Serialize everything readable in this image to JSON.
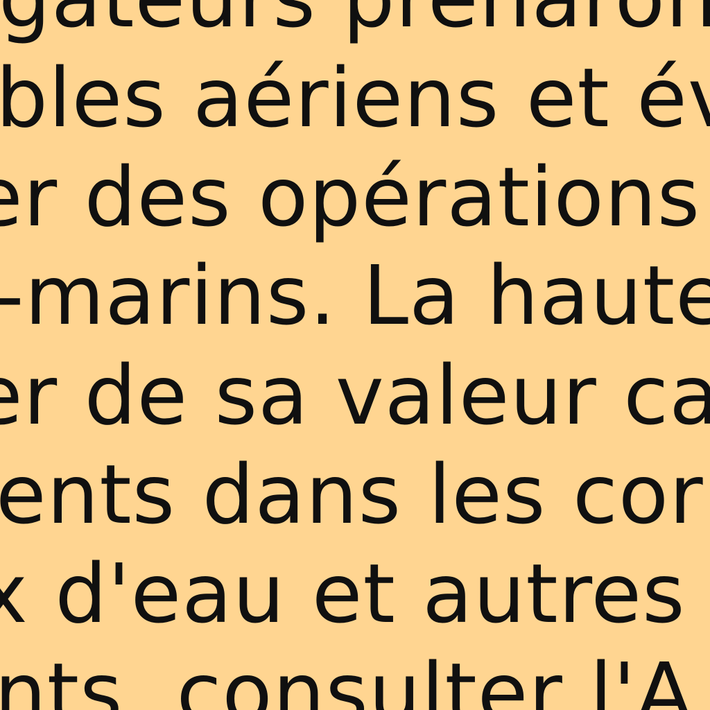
{
  "document": {
    "background": "#FFD591",
    "text_color": "#101010",
    "lines": [
      "gateurs prenaron",
      "bles aériens et év",
      "er des opérations d",
      "-marins. La haute",
      "er de sa valeur ca",
      "ents dans les cor",
      "x d'eau et autres fa",
      "nts, consulter l'A"
    ]
  }
}
